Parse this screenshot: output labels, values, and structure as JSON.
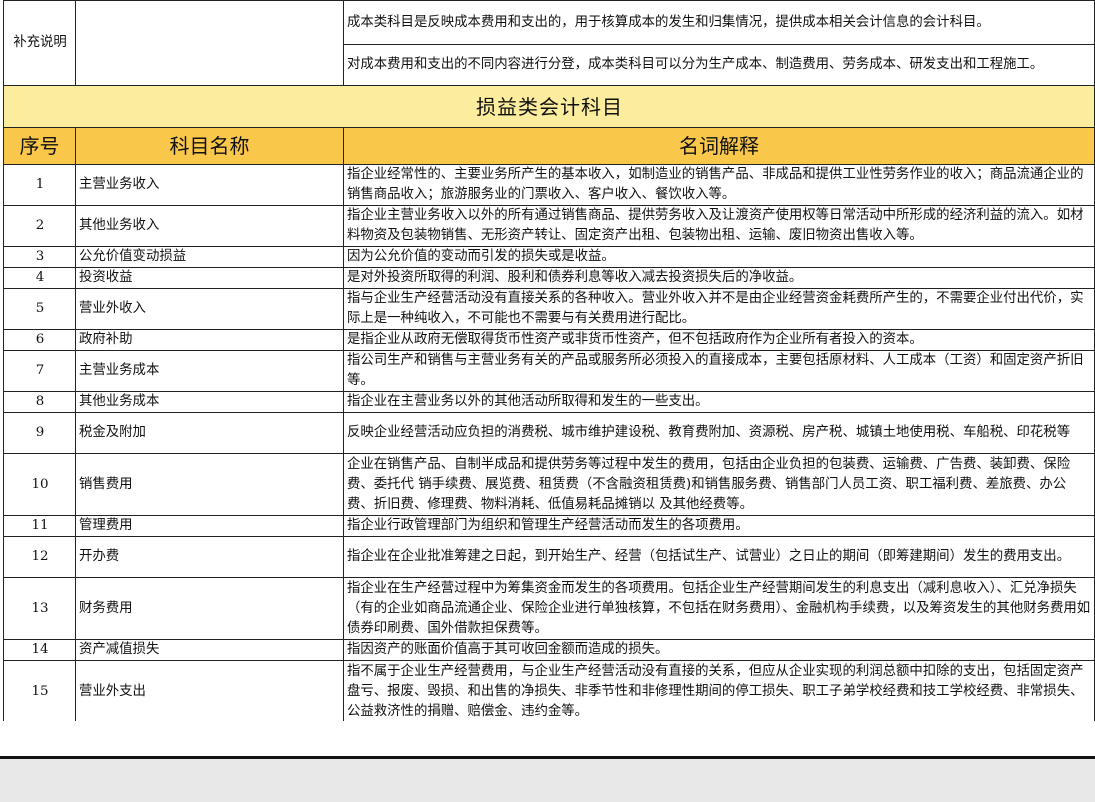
{
  "supplement": {
    "label": "补充说明",
    "rows": [
      "成本类科目是反映成本费用和支出的，用于核算成本的发生和归集情况，提供成本相关会计信息的会计科目。",
      "对成本费用和支出的不同内容进行分登，成本类科目可以分为生产成本、制造费用、劳务成本、研发支出和工程施工。"
    ]
  },
  "section_title": "损益类会计科目",
  "headers": {
    "index": "序号",
    "name": "科目名称",
    "desc": "名词解释"
  },
  "accounts": [
    {
      "no": "1",
      "name": "主营业务收入",
      "desc": "指企业经常性的、主要业务所产生的基本收入，如制造业的销售产品、非成品和提供工业性劳务作业的收入；商品流通企业的销售商品收入；旅游服务业的门票收入、客户收入、餐饮收入等。"
    },
    {
      "no": "2",
      "name": "其他业务收入",
      "desc": "指企业主营业务收入以外的所有通过销售商品、提供劳务收入及让渡资产使用权等日常活动中所形成的经济利益的流入。如材料物资及包装物销售、无形资产转让、固定资产出租、包装物出租、运输、废旧物资出售收入等。"
    },
    {
      "no": "3",
      "name": "公允价值变动损益",
      "desc": "因为公允价值的变动而引发的损失或是收益。"
    },
    {
      "no": "4",
      "name": "投资收益",
      "desc": "是对外投资所取得的利润、股利和债券利息等收入减去投资损失后的净收益。"
    },
    {
      "no": "5",
      "name": "营业外收入",
      "desc": "指与企业生产经营活动没有直接关系的各种收入。营业外收入并不是由企业经营资金耗费所产生的，不需要企业付出代价，实际上是一种纯收入，不可能也不需要与有关费用进行配比。"
    },
    {
      "no": "6",
      "name": "政府补助",
      "desc": "是指企业从政府无偿取得货币性资产或非货币性资产，但不包括政府作为企业所有者投入的资本。"
    },
    {
      "no": "7",
      "name": "主营业务成本",
      "desc": "指公司生产和销售与主营业务有关的产品或服务所必须投入的直接成本，主要包括原材料、人工成本（工资）和固定资产折旧等。"
    },
    {
      "no": "8",
      "name": "其他业务成本",
      "desc": "指企业在主营业务以外的其他活动所取得和发生的一些支出。"
    },
    {
      "no": "9",
      "name": "税金及附加",
      "desc": "反映企业经营活动应负担的消费税、城市维护建设税、教育费附加、资源税、房产税、城镇土地使用税、车船税、印花税等"
    },
    {
      "no": "10",
      "name": "销售费用",
      "desc": "企业在销售产品、自制半成品和提供劳务等过程中发生的费用，包括由企业负担的包装费、运输费、广告费、装卸费、保险费、委托代 销手续费、展览费、租赁费（不含融资租赁费)和销售服务费、销售部门人员工资、职工福利费、差旅费、办公费、折旧费、修理费、物料消耗、低值易耗品摊销以 及其他经费等。"
    },
    {
      "no": "11",
      "name": "管理费用",
      "desc": "指企业行政管理部门为组织和管理生产经营活动而发生的各项费用。"
    },
    {
      "no": "12",
      "name": "开办费",
      "desc": "指企业在企业批准筹建之日起，到开始生产、经营（包括试生产、试营业）之日止的期间（即筹建期间）发生的费用支出。"
    },
    {
      "no": "13",
      "name": "财务费用",
      "desc": "指企业在生产经营过程中为筹集资金而发生的各项费用。包括企业生产经营期间发生的利息支出（减利息收入）、汇兑净损失（有的企业如商品流通企业、保险企业进行单独核算，不包括在财务费用）、金融机构手续费，以及筹资发生的其他财务费用如债券印刷费、国外借款担保费等。"
    },
    {
      "no": "14",
      "name": "资产减值损失",
      "desc": "指因资产的账面价值高于其可收回金额而造成的损失。"
    },
    {
      "no": "15",
      "name": "营业外支出",
      "desc": "指不属于企业生产经营费用，与企业生产经营活动没有直接的关系，但应从企业实现的利润总额中扣除的支出，包括固定资产盘亏、报废、毁损、和出售的净损失、非季节性和非修理性期间的停工损失、职工子弟学校经费和技工学校经费、非常损失、公益救济性的捐赠、赔偿金、违约金等。"
    }
  ]
}
